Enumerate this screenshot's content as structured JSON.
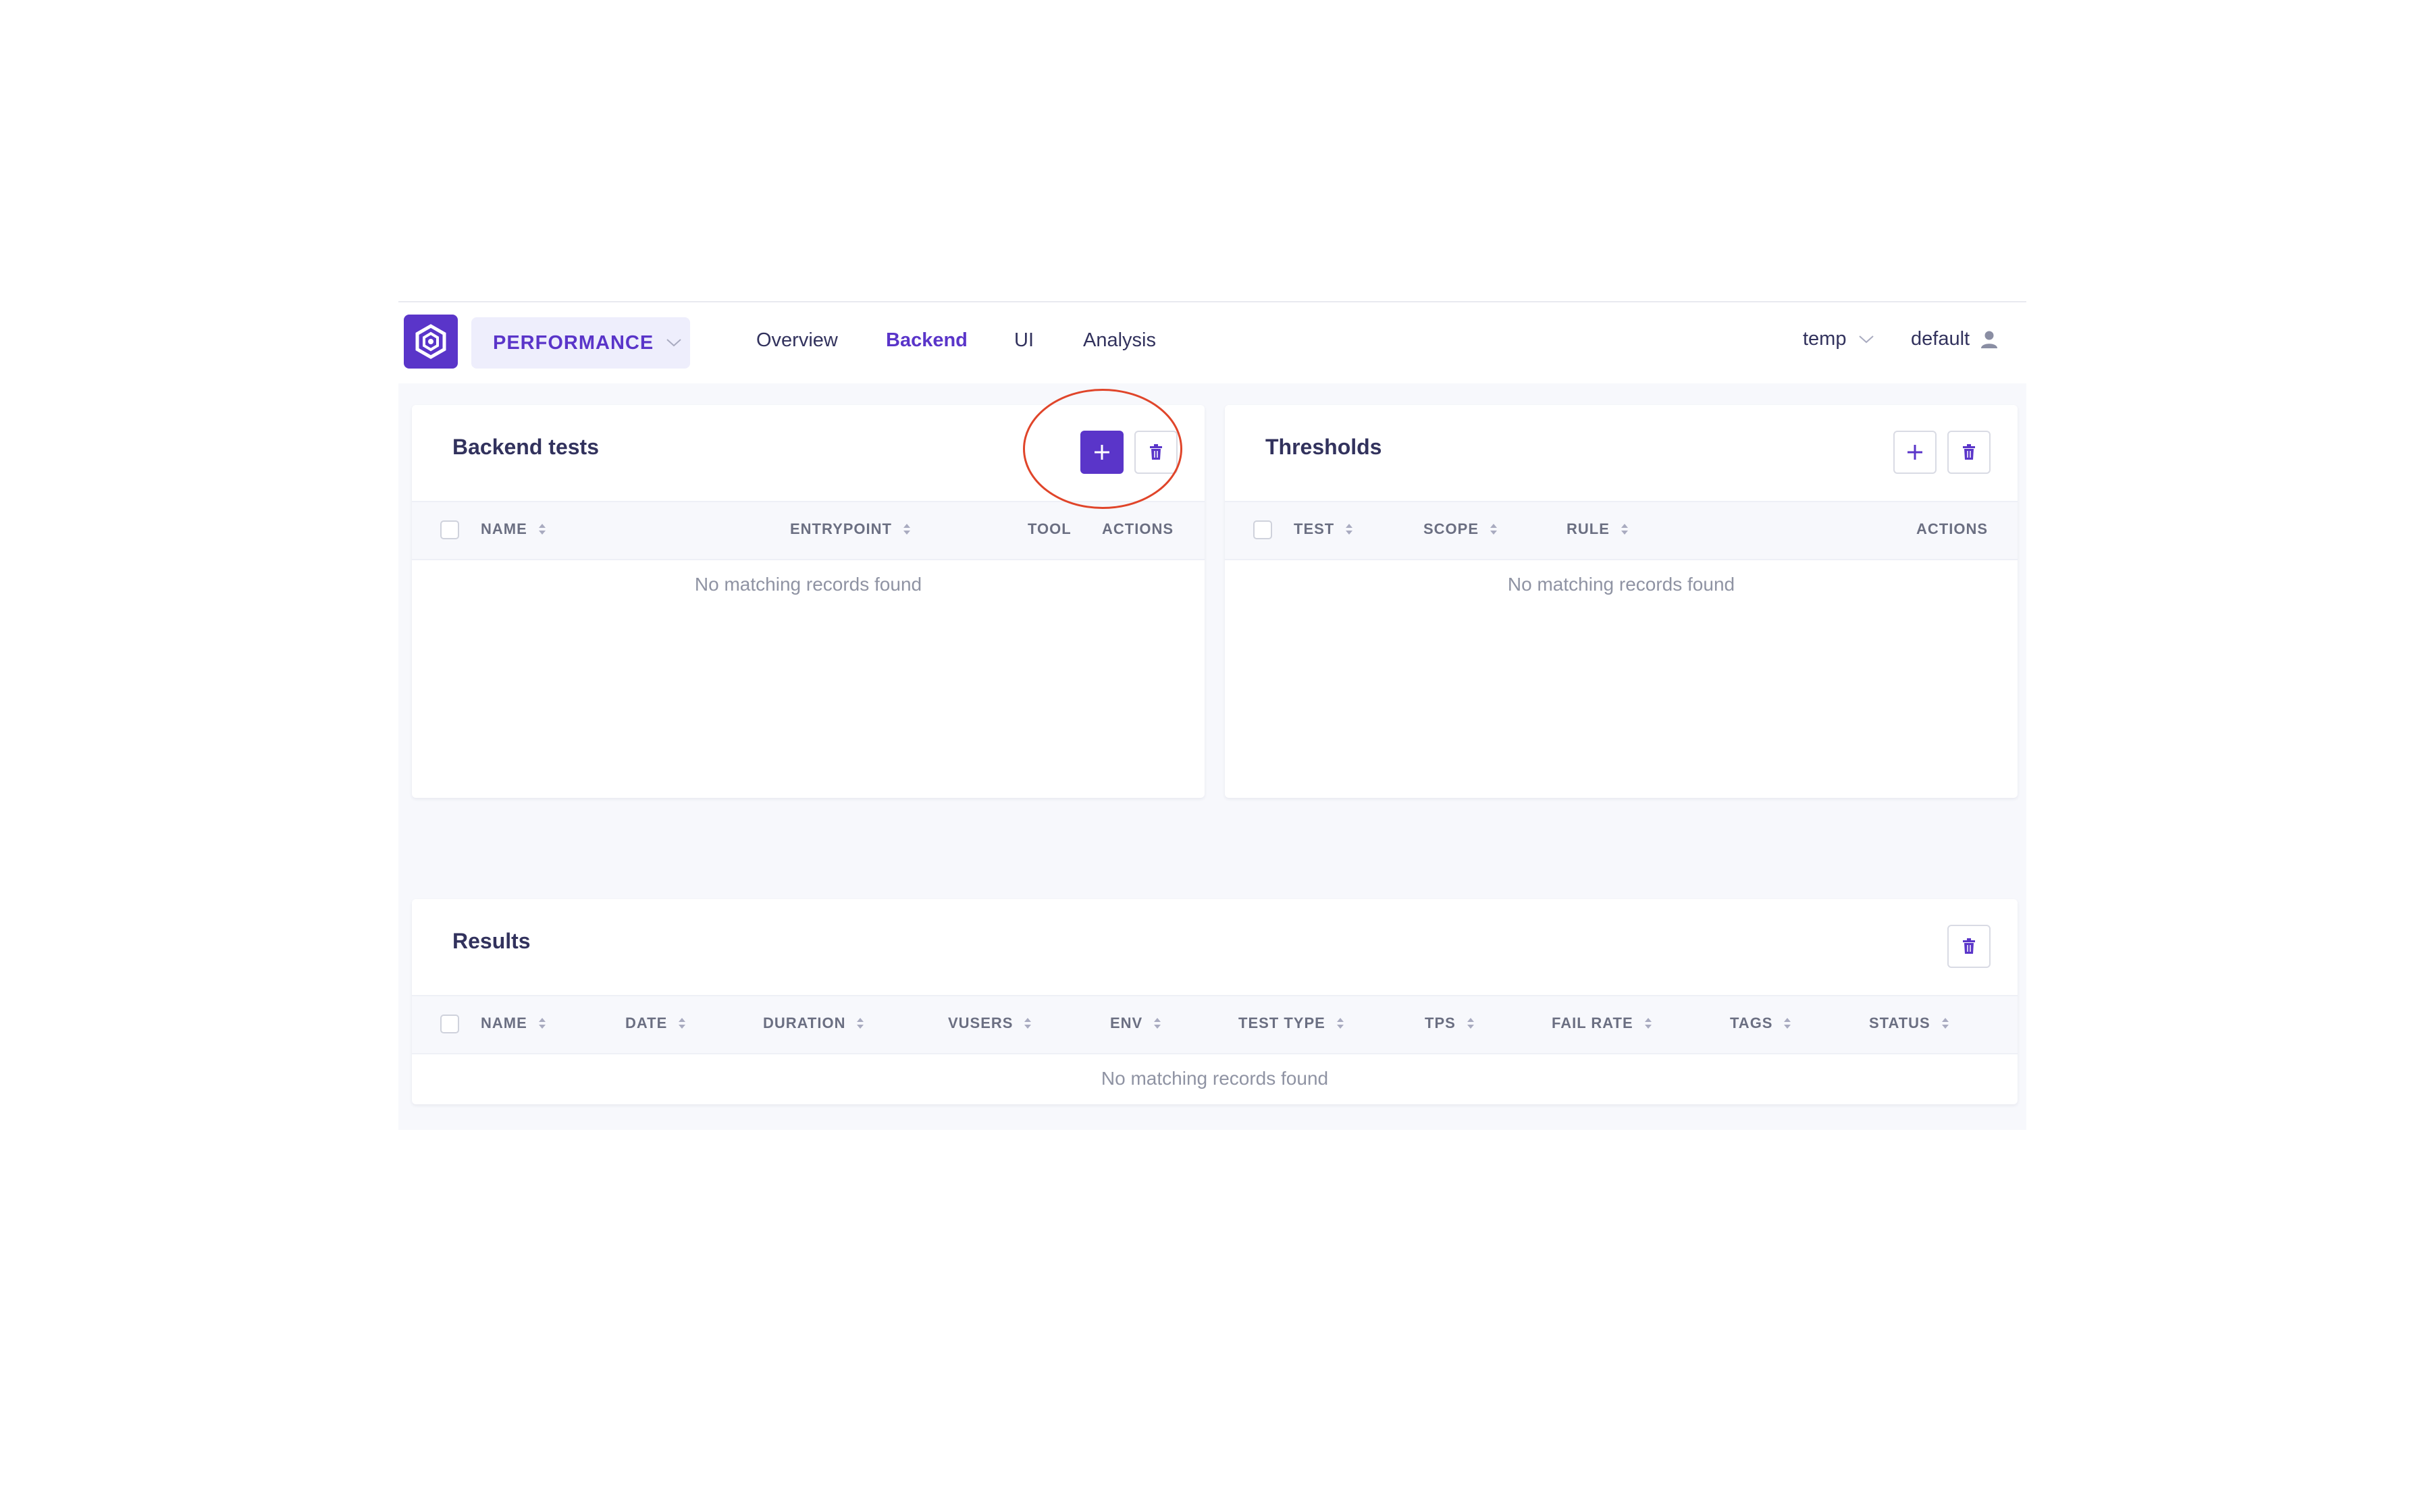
{
  "navbar": {
    "project": "PERFORMANCE",
    "tabs": [
      "Overview",
      "Backend",
      "UI",
      "Analysis"
    ],
    "active_tab": "Backend",
    "environment": "temp",
    "user": "default"
  },
  "backend_tests": {
    "title": "Backend tests",
    "columns": [
      "NAME",
      "ENTRYPOINT",
      "TOOL",
      "ACTIONS"
    ],
    "empty_text": "No matching records found"
  },
  "thresholds": {
    "title": "Thresholds",
    "columns": [
      "TEST",
      "SCOPE",
      "RULE",
      "ACTIONS"
    ],
    "empty_text": "No matching records found"
  },
  "results": {
    "title": "Results",
    "columns": [
      "NAME",
      "DATE",
      "DURATION",
      "VUSERS",
      "ENV",
      "TEST TYPE",
      "TPS",
      "FAIL RATE",
      "TAGS",
      "STATUS"
    ],
    "empty_text": "No matching records found"
  },
  "colors": {
    "accent": "#5a35c9",
    "highlight": "#e0452a",
    "background": "#f7f8fc"
  }
}
